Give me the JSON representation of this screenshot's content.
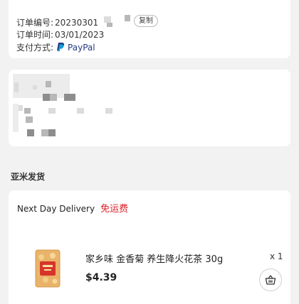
{
  "order": {
    "number_label": "订单编号:",
    "number_value": "20230301",
    "copy_label": "复制",
    "time_label": "订单时间:",
    "time_value": "03/01/2023",
    "payment_label": "支付方式:",
    "payment_value": "PayPal",
    "payment_icon": "paypal-icon"
  },
  "shipping": {
    "title": "亚米发货"
  },
  "delivery": {
    "name": "Next Day Delivery",
    "badge": "免运费",
    "badge_color": "#d91f26"
  },
  "product": {
    "name": "家乡味 金香菊 养生降火花茶 30g",
    "quantity": "x 1",
    "price": "$4.39",
    "cart_icon": "shopping-basket-icon"
  }
}
